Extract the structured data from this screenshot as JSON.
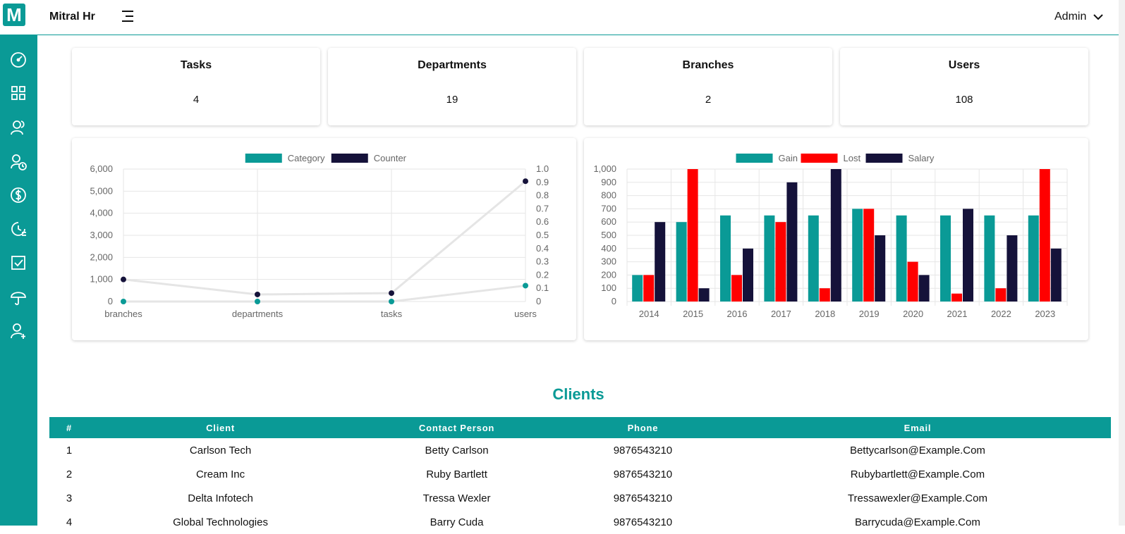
{
  "header": {
    "logo_letter": "M",
    "app_name": "Mitral Hr",
    "user_label": "Admin"
  },
  "sidebar": {
    "items": [
      {
        "icon": "dashboard-icon"
      },
      {
        "icon": "grid-icon"
      },
      {
        "icon": "users-icon"
      },
      {
        "icon": "user-clock-icon"
      },
      {
        "icon": "dollar-icon"
      },
      {
        "icon": "time-report-icon"
      },
      {
        "icon": "task-check-icon"
      },
      {
        "icon": "umbrella-icon"
      },
      {
        "icon": "add-user-icon"
      }
    ]
  },
  "stats": [
    {
      "title": "Tasks",
      "value": "4"
    },
    {
      "title": "Departments",
      "value": "19"
    },
    {
      "title": "Branches",
      "value": "2"
    },
    {
      "title": "Users",
      "value": "108"
    }
  ],
  "chart_data": [
    {
      "type": "line",
      "categories": [
        "branches",
        "departments",
        "tasks",
        "users"
      ],
      "legend": [
        "Category",
        "Counter"
      ],
      "legend_position": "top",
      "y_left": {
        "ticks": [
          "0",
          "1,000",
          "2,000",
          "3,000",
          "4,000",
          "5,000",
          "6,000"
        ],
        "ylim": [
          0,
          6000
        ]
      },
      "y_right": {
        "ticks": [
          "0",
          "0.1",
          "0.2",
          "0.3",
          "0.4",
          "0.5",
          "0.6",
          "0.7",
          "0.8",
          "0.9",
          "1.0"
        ],
        "ylim": [
          0,
          1
        ]
      },
      "series": [
        {
          "name": "Category",
          "axis": "right",
          "color": "#0a9a96",
          "values": [
            0,
            0,
            0,
            0.12
          ]
        },
        {
          "name": "Counter",
          "axis": "left",
          "color": "#15123a",
          "values": [
            1000,
            320,
            380,
            5450
          ]
        }
      ],
      "grid": true
    },
    {
      "type": "bar",
      "categories": [
        "2014",
        "2015",
        "2016",
        "2017",
        "2018",
        "2019",
        "2020",
        "2021",
        "2022",
        "2023"
      ],
      "legend": [
        "Gain",
        "Lost",
        "Salary"
      ],
      "legend_position": "top",
      "ylim": [
        0,
        1000
      ],
      "yticks": [
        "0",
        "100",
        "200",
        "300",
        "400",
        "500",
        "600",
        "700",
        "800",
        "900",
        "1,000"
      ],
      "series": [
        {
          "name": "Gain",
          "color": "#0a9a96",
          "values": [
            200,
            600,
            650,
            650,
            650,
            700,
            650,
            650,
            650,
            650
          ]
        },
        {
          "name": "Lost",
          "color": "#ff0000",
          "values": [
            200,
            1000,
            200,
            600,
            100,
            700,
            300,
            60,
            100,
            1000
          ]
        },
        {
          "name": "Salary",
          "color": "#15123a",
          "values": [
            600,
            100,
            400,
            900,
            1000,
            500,
            200,
            700,
            500,
            400
          ]
        }
      ],
      "grid": true
    }
  ],
  "clients": {
    "title": "Clients",
    "columns": [
      "#",
      "Client",
      "Contact Person",
      "Phone",
      "Email"
    ],
    "rows": [
      [
        "1",
        "Carlson Tech",
        "Betty Carlson",
        "9876543210",
        "Bettycarlson@Example.Com"
      ],
      [
        "2",
        "Cream Inc",
        "Ruby Bartlett",
        "9876543210",
        "Rubybartlett@Example.Com"
      ],
      [
        "3",
        "Delta Infotech",
        "Tressa Wexler",
        "9876543210",
        "Tressawexler@Example.Com"
      ],
      [
        "4",
        "Global Technologies",
        "Barry Cuda",
        "9876543210",
        "Barrycuda@Example.Com"
      ]
    ]
  }
}
